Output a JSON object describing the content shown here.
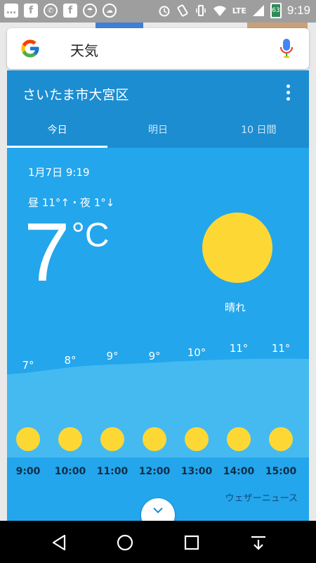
{
  "status_bar": {
    "time": "9:19",
    "battery": "63",
    "network": "LTE",
    "left_icons": [
      "chat-bubble-icon",
      "facebook-icon",
      "wifi-call-icon",
      "facebook-icon",
      "rain-10-icon",
      "cloud-icon"
    ],
    "right_icons": [
      "alarm-icon",
      "rotate-icon",
      "vibrate-icon",
      "wifi-icon",
      "signal-icon",
      "battery-icon"
    ]
  },
  "search": {
    "query": "天気"
  },
  "weather": {
    "location": "さいたま市大宮区",
    "tabs": [
      {
        "label": "今日",
        "active": true
      },
      {
        "label": "明日",
        "active": false
      },
      {
        "label": "10 日間",
        "active": false
      }
    ],
    "datetime": "1月7日 9:19",
    "hilo": "昼 11°↑・夜 1°↓",
    "temperature": "7",
    "unit": "°C",
    "condition": "晴れ",
    "hourly": [
      {
        "time": "9:00",
        "temp": "7°"
      },
      {
        "time": "10:00",
        "temp": "8°"
      },
      {
        "time": "11:00",
        "temp": "9°"
      },
      {
        "time": "12:00",
        "temp": "9°"
      },
      {
        "time": "13:00",
        "temp": "10°"
      },
      {
        "time": "14:00",
        "temp": "11°"
      },
      {
        "time": "15:00",
        "temp": "11°"
      }
    ],
    "source": "ウェザーニュース"
  },
  "colors": {
    "card_body": "#23a6ec",
    "card_header": "#1c8dd1",
    "sun": "#fdd835"
  }
}
